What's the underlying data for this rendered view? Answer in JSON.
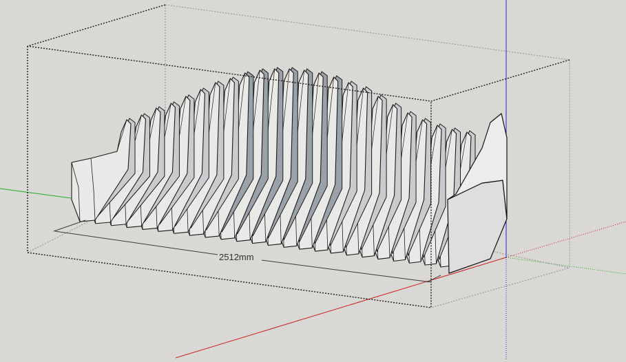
{
  "viewport": {
    "background": "#d9d8d4",
    "axis_colors": {
      "x": "#cc1f1f",
      "y": "#22aa22",
      "z": "#2222cc"
    }
  },
  "model": {
    "fin_count": 24,
    "face_color": "#e9e9e7",
    "shade_color": "#c9cbce",
    "back_color": "#9aa1a8",
    "edge_color": "#1a1a1a"
  },
  "dimension": {
    "label": "2512mm"
  }
}
